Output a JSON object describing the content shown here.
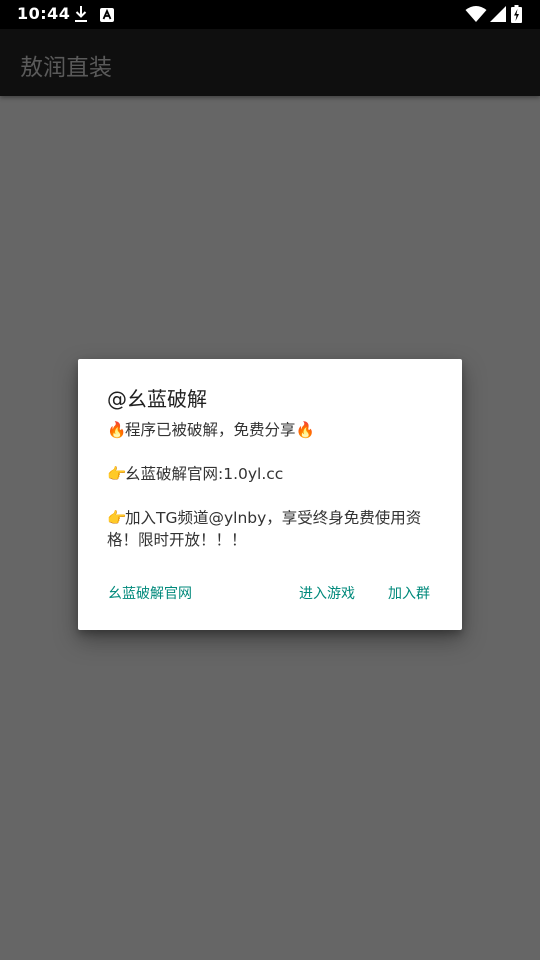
{
  "status_bar": {
    "time": "10:44",
    "icons": [
      "download-icon",
      "a-badge-icon",
      "wifi-icon",
      "signal-icon",
      "battery-charging-icon"
    ]
  },
  "app_bar": {
    "title": "敖润直装"
  },
  "dialog": {
    "title": "@幺蓝破解",
    "message": {
      "line1_emoji": "🔥",
      "line1_text": "程序已被破解，免费分享",
      "line1_emoji_end": "🔥",
      "line2_emoji": "👉",
      "line2_text": "幺蓝破解官网:1.0yl.cc",
      "line3_emoji": "👉",
      "line3_text": "加入TG频道@ylnby，享受终身免费使用资格！限时开放！！！"
    },
    "buttons": {
      "website": "幺蓝破解官网",
      "enter_game": "进入游戏",
      "join_group": "加入群"
    }
  },
  "colors": {
    "accent": "#00897b",
    "scrim": "#666666",
    "status_bar": "#000000",
    "app_bar": "#0f0f0f"
  }
}
